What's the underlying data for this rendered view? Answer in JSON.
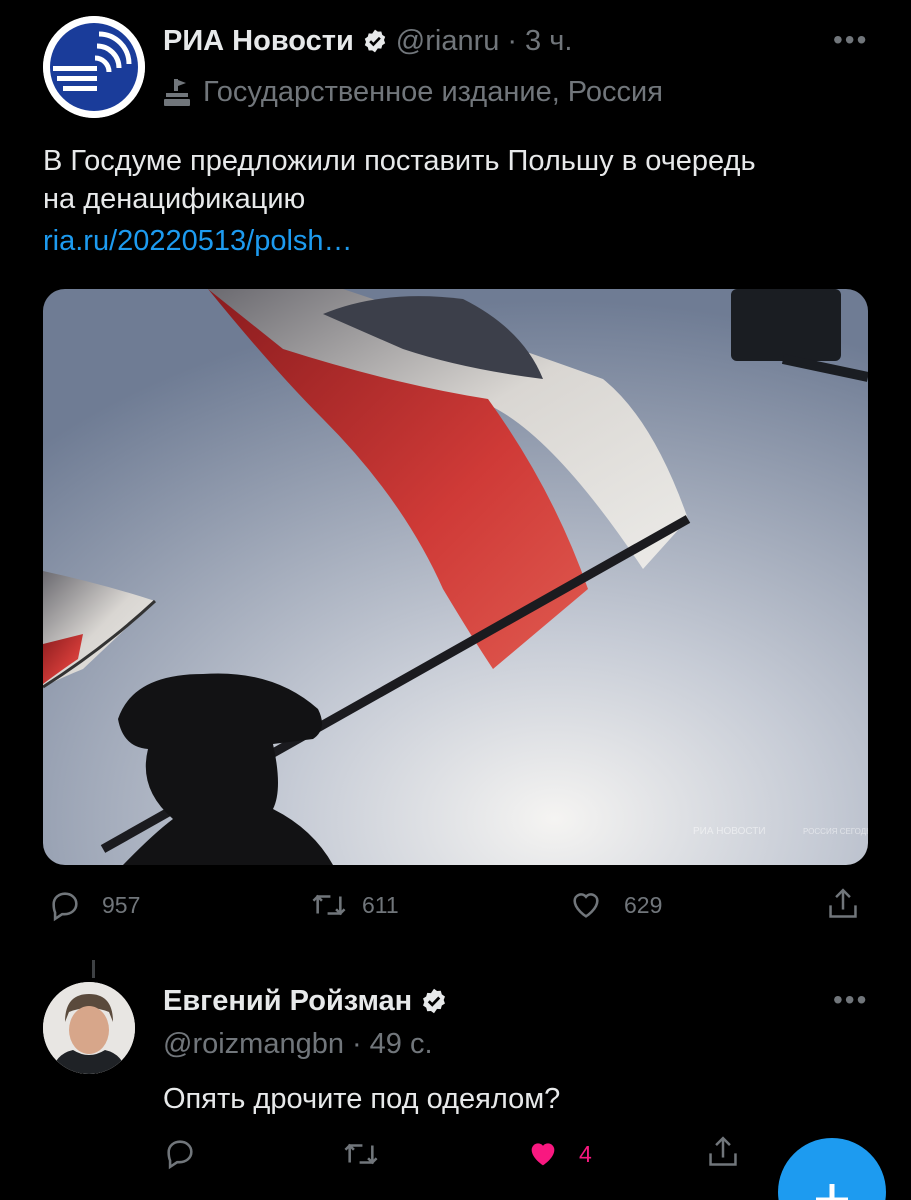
{
  "tweet": {
    "author_name": "РИА Новости",
    "handle": "@rianru",
    "separator": "·",
    "time": "3 ч.",
    "affiliation": "Государственное издание, Россия",
    "text": "В Госдуме предложили поставить Польшу в очередь на денацификацию",
    "link": "ria.ru/20220513/polsh…",
    "media": {
      "watermark_left": "РИА НОВОСТИ",
      "watermark_right": "РОССИЯ СЕГОДНЯ"
    },
    "actions": {
      "replies": "957",
      "retweets": "611",
      "likes": "629"
    }
  },
  "reply": {
    "author_name": "Евгений Ройзман",
    "handle": "@roizmangbn",
    "separator": "·",
    "time": "49 с.",
    "text": "Опять дрочите под одеялом?",
    "actions": {
      "likes": "4"
    }
  },
  "colors": {
    "background": "#000000",
    "accent": "#1d9bf0",
    "like": "#f91880",
    "muted": "#71767b"
  },
  "icons": [
    "rian-logo",
    "verified-badge",
    "government-label-icon",
    "more-options-icon",
    "reply-icon",
    "retweet-icon",
    "like-icon",
    "share-icon",
    "compose-plus-icon"
  ]
}
